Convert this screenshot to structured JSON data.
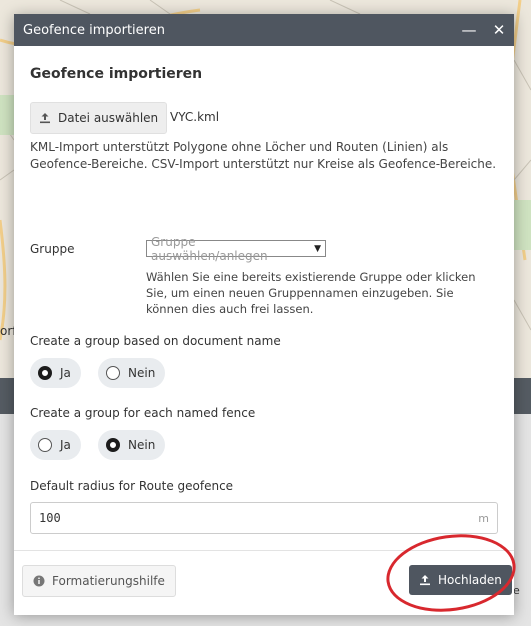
{
  "modal": {
    "window_title": "Geofence importieren",
    "minimize_icon": "minimize-icon",
    "close_icon": "close-icon",
    "heading": "Geofence importieren",
    "file": {
      "button_label": "Datei auswählen",
      "button_icon": "upload-icon",
      "file_name": "VYC.kml"
    },
    "info": "KML-Import unterstützt Polygone ohne Löcher und Routen (Linien) als Geofence-Bereiche. CSV-Import unterstützt nur Kreise als Geofence-Bereiche.",
    "group": {
      "label": "Gruppe",
      "select_placeholder": "Gruppe auswählen/anlegen",
      "help": "Wählen Sie eine bereits existierende Gruppe oder klicken Sie, um einen neuen Gruppennamen einzugeben. Sie können dies auch frei lassen."
    },
    "doc_group": {
      "label": "Create a group based on document name",
      "options": [
        {
          "label": "Ja",
          "checked": true
        },
        {
          "label": "Nein",
          "checked": false
        }
      ]
    },
    "fence_group": {
      "label": "Create a group for each named fence",
      "options": [
        {
          "label": "Ja",
          "checked": false
        },
        {
          "label": "Nein",
          "checked": true
        }
      ]
    },
    "radius": {
      "label": "Default radius for Route geofence",
      "value": "100",
      "unit": "m"
    },
    "footer": {
      "help_label": "Formatierungshilfe",
      "help_icon": "info-icon",
      "upload_label": "Hochladen",
      "upload_icon": "upload-icon"
    }
  },
  "background": {
    "map_label_left": "orf",
    "edge_text": "e"
  },
  "colors": {
    "header_bg": "#4f5660",
    "highlight_ring": "#d8282e",
    "primary_button": "#4f5660"
  }
}
